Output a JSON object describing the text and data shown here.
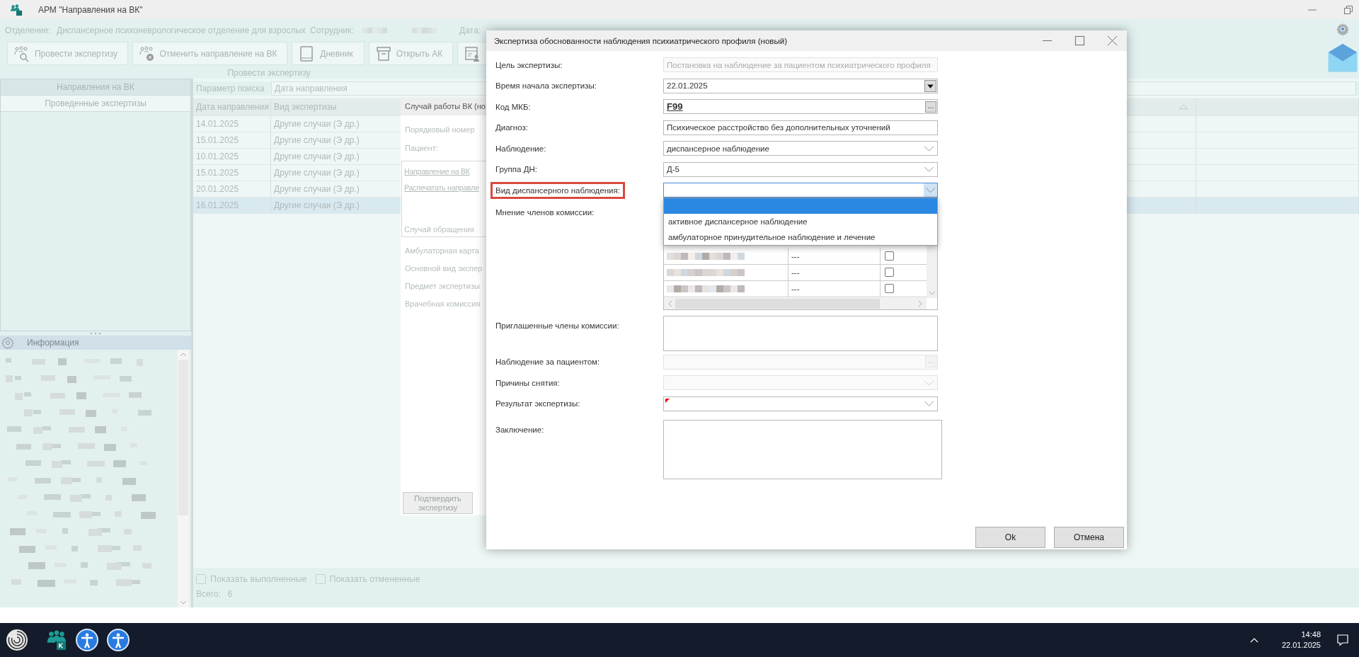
{
  "app": {
    "title": "АРМ \"Направления на ВК\""
  },
  "header": {
    "department_label": "Отделение:",
    "department": "Диспансерное психоневрологическое отделение для взрослых",
    "employee_label": "Сотрудник:",
    "date_label": "Дата:"
  },
  "toolbar": {
    "caption": "Провести экспертизу",
    "buttons": [
      "Провести экспертизу",
      "Отменить направление на ВК",
      "Дневник",
      "Открыть АК"
    ]
  },
  "left_panel": {
    "tabs": [
      {
        "label": "Направления на ВК",
        "selected": false
      },
      {
        "label": "Проведенные экспертизы",
        "selected": true
      }
    ]
  },
  "info_panel": {
    "title": "Информация"
  },
  "search": {
    "label": "Параметр поиска",
    "value": "Дата направления"
  },
  "table": {
    "columns": [
      "Дата направления",
      "Вид экспертизы"
    ],
    "rows": [
      {
        "date": "14.01.2025",
        "type": "Другие случаи (Э др.)",
        "selected": false
      },
      {
        "date": "15.01.2025",
        "type": "Другие случаи (Э др.)",
        "selected": false
      },
      {
        "date": "10.01.2025",
        "type": "Другие случаи (Э др.)",
        "selected": false
      },
      {
        "date": "15.01.2025",
        "type": "Другие случаи (Э др.)",
        "selected": false
      },
      {
        "date": "20.01.2025",
        "type": "Другие случаи (Э др.)",
        "selected": false
      },
      {
        "date": "16.01.2025",
        "type": "Другие случаи (Э др.)",
        "selected": true
      }
    ]
  },
  "case_panel": {
    "title": "Случай работы ВК (но",
    "top_fields": [
      "Порядковый номер",
      "Пациент:"
    ],
    "links": [
      "Направление на ВК",
      "Распечатать направле"
    ],
    "box_footer": "Случай обращения",
    "fields": [
      "Амбулаторная карта",
      "Основной вид экспер",
      "Предмет экспертизы",
      "Врачебная комиссия"
    ],
    "confirm_button": "Подтвердить экспертизу"
  },
  "footer": {
    "checkboxes": [
      {
        "label": "Показать выполненные",
        "checked": false
      },
      {
        "label": "Показать отмененные",
        "checked": false
      }
    ],
    "total_label": "Всего:",
    "total": "6"
  },
  "dialog": {
    "title": "Экспертиза обоснованности наблюдения психиатрического профиля (новый)",
    "fields": [
      {
        "label": "Цель экспертизы:",
        "kind": "combo",
        "value": "Постановка на наблюдение за пациентом психиатрического профиля",
        "disabled": true,
        "required": false,
        "highlighted": false
      },
      {
        "label": "Время начала экспертизы:",
        "kind": "date",
        "value": "22.01.2025",
        "disabled": false,
        "required": false,
        "highlighted": false
      },
      {
        "label": "Код МКБ:",
        "kind": "code",
        "value": "F99",
        "button": "...",
        "disabled": false,
        "required": false,
        "highlighted": false
      },
      {
        "label": "Диагноз:",
        "kind": "text",
        "value": "Психическое расстройство без дополнительных уточнений",
        "disabled": false,
        "required": false,
        "highlighted": false
      },
      {
        "label": "Наблюдение:",
        "kind": "combo",
        "value": "диспансерное наблюдение",
        "disabled": false,
        "required": false,
        "highlighted": false
      },
      {
        "label": "Группа ДН:",
        "kind": "combo",
        "value": "Д-5",
        "disabled": false,
        "required": false,
        "highlighted": false
      },
      {
        "label": "Вид диспансерного наблюдения:",
        "kind": "combo",
        "disabled": false,
        "required": false,
        "highlighted": true,
        "options": [
          {
            "selected": true
          },
          {
            "label": "активное диспансерное наблюдение",
            "selected": false
          },
          {
            "label": "амбулаторное принудительное наблюдение и лечение",
            "selected": false
          }
        ]
      },
      {
        "label": "Мнение членов комиссии:",
        "kind": "table",
        "disabled": false,
        "required": false,
        "highlighted": false,
        "rows": [
          {
            "opinion": "---",
            "checked": false
          },
          {
            "opinion": "---",
            "checked": false
          },
          {
            "opinion": "---",
            "checked": false
          }
        ]
      },
      {
        "label": "Приглашенные члены комиссии:",
        "kind": "textarea",
        "disabled": false,
        "required": false,
        "highlighted": false
      },
      {
        "label": "Наблюдение за пациентом:",
        "kind": "lookup",
        "button": "...",
        "disabled": true,
        "required": false,
        "highlighted": false
      },
      {
        "label": "Причины снятия:",
        "kind": "combo",
        "disabled": true,
        "required": false,
        "highlighted": false
      },
      {
        "label": "Результат экспертизы:",
        "kind": "combo",
        "disabled": false,
        "required": true,
        "highlighted": false
      },
      {
        "label": "Заключение:",
        "kind": "textarea",
        "disabled": false,
        "required": false,
        "highlighted": false
      }
    ],
    "buttons": [
      "Ok",
      "Отмена"
    ]
  },
  "taskbar": {
    "time": "14:48",
    "date": "22.01.2025"
  }
}
